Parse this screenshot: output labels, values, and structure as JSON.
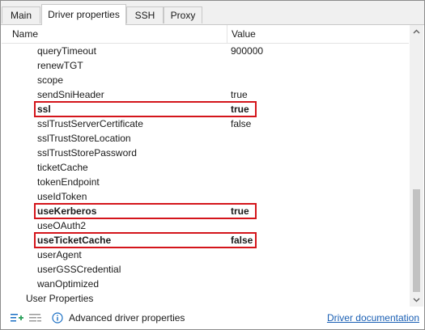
{
  "tabs": [
    {
      "label": "Main"
    },
    {
      "label": "Driver properties"
    },
    {
      "label": "SSH"
    },
    {
      "label": "Proxy"
    }
  ],
  "table": {
    "header_name": "Name",
    "header_value": "Value",
    "rows": [
      {
        "name": "queryTimeout",
        "value": "900000"
      },
      {
        "name": "renewTGT",
        "value": ""
      },
      {
        "name": "scope",
        "value": ""
      },
      {
        "name": "sendSniHeader",
        "value": "true"
      },
      {
        "name": "ssl",
        "value": "true",
        "highlighted": true
      },
      {
        "name": "sslTrustServerCertificate",
        "value": "false"
      },
      {
        "name": "sslTrustStoreLocation",
        "value": ""
      },
      {
        "name": "sslTrustStorePassword",
        "value": ""
      },
      {
        "name": "ticketCache",
        "value": ""
      },
      {
        "name": "tokenEndpoint",
        "value": ""
      },
      {
        "name": "useIdToken",
        "value": ""
      },
      {
        "name": "useKerberos",
        "value": "true",
        "highlighted": true
      },
      {
        "name": "useOAuth2",
        "value": ""
      },
      {
        "name": "useTicketCache",
        "value": "false",
        "highlighted": true
      },
      {
        "name": "userAgent",
        "value": ""
      },
      {
        "name": "userGSSCredential",
        "value": ""
      },
      {
        "name": "wanOptimized",
        "value": ""
      }
    ],
    "group_label": "User Properties"
  },
  "toolbar": {
    "add_icon": "add-property-icon",
    "remove_icon": "remove-property-icon",
    "info_icon": "info-icon",
    "advanced_label": "Advanced driver properties",
    "doc_link": "Driver documentation"
  },
  "colors": {
    "highlight_border": "#d4151b",
    "link": "#1a5fb4",
    "add_icon": "#2aa05a",
    "info_icon": "#1a6fc4"
  }
}
